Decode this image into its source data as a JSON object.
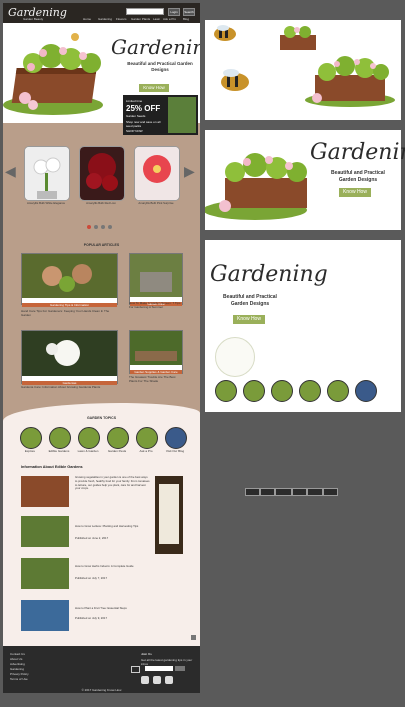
{
  "header": {
    "logo": "Gardening",
    "logo_sub": "Garden Beauty",
    "buttons": [
      "Login",
      "Search"
    ],
    "nav": [
      "Home",
      "Gardening",
      "Flowers",
      "Garden Plants",
      "Lawn",
      "Ask a Pro",
      "Blog"
    ]
  },
  "hero": {
    "title": "Gardening",
    "subtitle": "Beautiful and Practical Garden Designs",
    "cta": "Know How"
  },
  "promo": {
    "line1": "Limited time",
    "percent": "25% OFF",
    "line3": "Garden Seeds",
    "line4": "Shop now and save on all seed packs",
    "cta": "SHOP NOW"
  },
  "carousel": {
    "captions": [
      "Amaryllis Bulb White Elegance",
      "Amaryllis Bulb Red Lion",
      "Amaryllis Bulb Pink Surprise"
    ]
  },
  "popular": {
    "heading": "POPULAR ARTICLES",
    "items": [
      {
        "bar": "Gardening Tips & Information",
        "text": "Hand Care Tips For Gardeners: Keeping Your Hands Clean In The Garden"
      },
      {
        "bar": "Garden Care",
        "text": "How To Make A Garden Screen: 7 Tips For Gardening A Summer"
      },
      {
        "bar": "Gardenias",
        "text": "Gardenia Care: Information About Growing Gardenia Plants"
      },
      {
        "bar": "Garden Supplies & Garden Care",
        "text": "The Greatest Trouble Are The Best Plants For The Shade"
      }
    ]
  },
  "topics": {
    "heading": "GARDEN TOPICS",
    "items": [
      "Explore",
      "Edible Gardens",
      "Lawn & Garden",
      "Garden Pests",
      "Ask a Pro",
      "Visit Our Blog"
    ]
  },
  "info": {
    "heading": "Information About Edible Gardens",
    "lead": "Growing vegetables in your garden is one of the best ways to provide fresh, healthy food for your family. From tomatoes to lettuce, our guides help you plant, care for and harvest your crops.",
    "items": [
      {
        "title": "How to Grow Lettuce: Planting and Harvesting Tips",
        "meta": "Published on June 2, 2017"
      },
      {
        "title": "How to Grow Herbs Indoors: A Complete Guide",
        "meta": "Published on July 7, 2017"
      },
      {
        "title": "How to Plant a Fruit Tree: Essential Steps",
        "meta": "Published on July 9, 2017"
      }
    ]
  },
  "footer": {
    "links": [
      "Contact Us",
      "About Us",
      "Advertising",
      "Gardening",
      "Privacy Policy",
      "Terms of Use"
    ],
    "join": "Join Us",
    "join_text": "Get all the latest gardening tips in your inbox",
    "copyright": "© 2017 Gardening Know How"
  },
  "right": {
    "title1": "Gardening",
    "subtitle1": "Beautiful and Practical Garden Designs",
    "cta1": "Know How",
    "title2": "Gardening",
    "subtitle2": "Beautiful and Practical Garden Designs",
    "cta2": "Know How"
  },
  "colors": {
    "accent": "#9ab05a",
    "bar": "#c6653a",
    "dark": "#2b2b2b",
    "page": "#b99e8a"
  }
}
